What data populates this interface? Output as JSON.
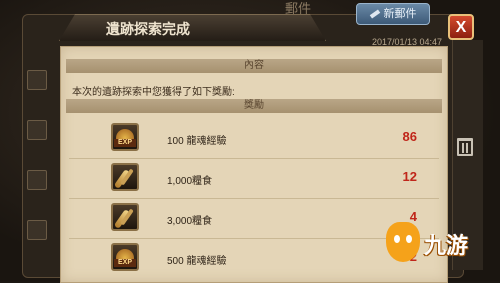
{
  "background": {
    "tab_label": "郵件",
    "write_button_label": "新郵件",
    "close_label": "X"
  },
  "dialog": {
    "title": "遺跡探索完成",
    "date": "2017/01/13 04:47",
    "content_header": "內容",
    "description": "本次的遺跡探索中您獲得了如下獎勵:",
    "reward_header": "獎勵",
    "rewards": [
      {
        "icon": "exp-scroll-icon",
        "name": "100 龍魂經驗",
        "quantity": "86"
      },
      {
        "icon": "food-ration-icon",
        "name": "1,000糧食",
        "quantity": "12"
      },
      {
        "icon": "food-ration-icon",
        "name": "3,000糧食",
        "quantity": "4"
      },
      {
        "icon": "exp-scroll-icon",
        "name": "500 龍魂經驗",
        "quantity": "2"
      }
    ]
  },
  "watermark": {
    "text": "九游"
  },
  "colors": {
    "accent": "#c0261a",
    "paper": "#e4d5b7",
    "close": "#d44b2e"
  }
}
